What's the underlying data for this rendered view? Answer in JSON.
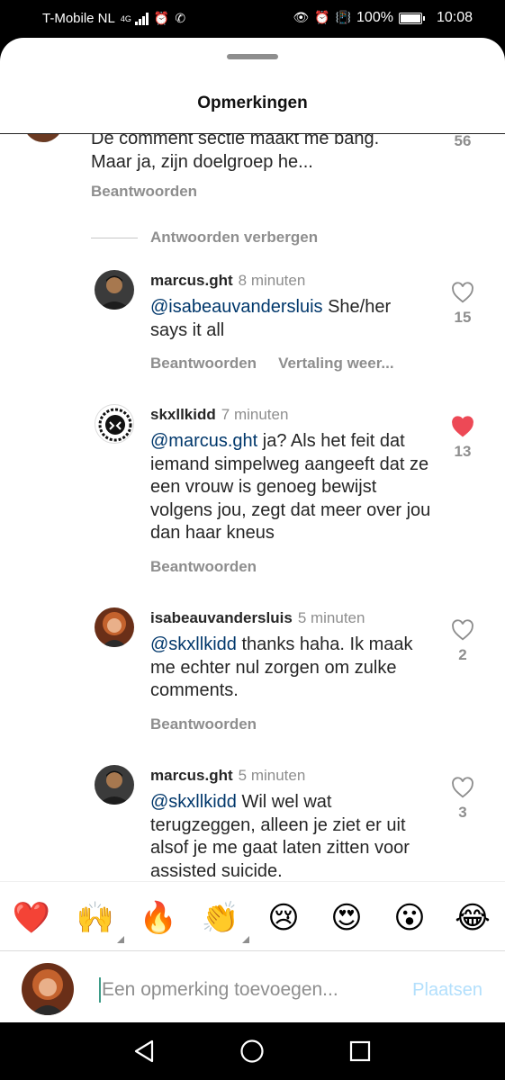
{
  "status_bar": {
    "carrier": "T-Mobile NL",
    "network": "4G",
    "battery": "100%",
    "battery_level": 1.0,
    "time": "10:08"
  },
  "sheet": {
    "title": "Opmerkingen"
  },
  "parent_comment": {
    "text_line1": "De comment sectie maakt me bang.",
    "text_line2": "Maar ja, zijn doelgroep he...",
    "reply_label": "Beantwoorden",
    "like_count": "56"
  },
  "hide_replies_label": "Antwoorden verbergen",
  "comments": [
    {
      "username": "marcus.ght",
      "time": "8 minuten",
      "mention": "@isabeauvandersluis",
      "text": " She/her says it all",
      "reply_label": "Beantwoorden",
      "translate_label": "Vertaling weer...",
      "likes": "15",
      "liked": false
    },
    {
      "username": "skxllkidd",
      "time": "7 minuten",
      "mention": "@marcus.ght",
      "text": " ja? Als het feit dat iemand simpelweg aangeeft dat ze een vrouw is genoeg bewijst volgens jou, zegt dat meer over jou dan haar kneus",
      "reply_label": "Beantwoorden",
      "likes": "13",
      "liked": true
    },
    {
      "username": "isabeauvandersluis",
      "time": "5 minuten",
      "mention": "@skxllkidd",
      "text": " thanks haha. Ik maak me echter nul zorgen om zulke comments.",
      "reply_label": "Beantwoorden",
      "likes": "2",
      "liked": false
    },
    {
      "username": "marcus.ght",
      "time": "5 minuten",
      "mention": "@skxllkidd",
      "text": " Wil wel wat terugzeggen, alleen je ziet er uit alsof je me gaat laten zitten voor assisted suicide.",
      "likes": "3",
      "liked": false
    }
  ],
  "emoji_bar": [
    {
      "name": "red-heart",
      "glyph": "❤️"
    },
    {
      "name": "raising-hands",
      "glyph": "🙌"
    },
    {
      "name": "fire",
      "glyph": "🔥"
    },
    {
      "name": "clapping-hands",
      "glyph": "👏"
    },
    {
      "name": "crying-face",
      "glyph": "😢"
    },
    {
      "name": "heart-eyes",
      "glyph": "😍"
    },
    {
      "name": "surprised-face",
      "glyph": "😮"
    },
    {
      "name": "tears-of-joy",
      "glyph": "😂"
    }
  ],
  "comment_input": {
    "placeholder": "Een opmerking toevoegen...",
    "post_label": "Plaatsen"
  },
  "colors": {
    "mention": "#00376b",
    "liked_heart": "#ed4956",
    "post_disabled": "#b2dffc"
  }
}
